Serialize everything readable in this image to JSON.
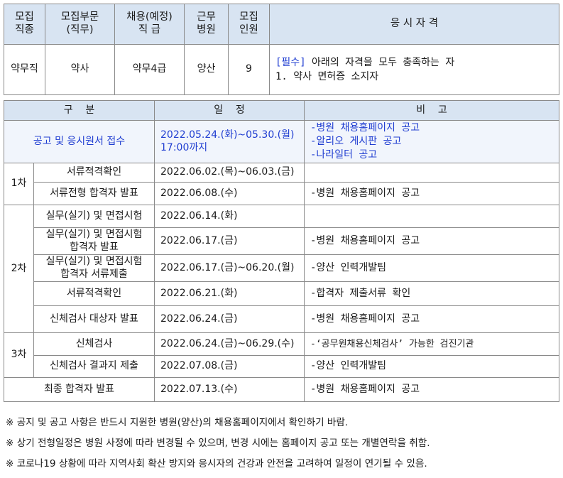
{
  "recruit": {
    "headers": [
      "모집\n직종",
      "모집부문\n(직무)",
      "채용(예정)\n직 급",
      "근무\n병원",
      "모집\n인원",
      "응 시 자 격"
    ],
    "row": {
      "job_type": "약무직",
      "dept": "약사",
      "grade": "약무4급",
      "hospital": "양산",
      "count": "9",
      "qual_tag": "[필수]",
      "qual_text": " 아래의 자격을 모두 충족하는 자",
      "qual_item": "1. 약사 면허증 소지자"
    }
  },
  "schedule": {
    "headers": {
      "category": "구    분",
      "date": "일    정",
      "remark": "비    고"
    },
    "announce": {
      "label": "공고 및 응시원서 접수",
      "date": "2022.05.24.(화)~05.30.(월)\n17:00까지",
      "remarks": [
        "-병원 채용홈페이지 공고",
        "-알리오 게시판 공고",
        "-나라일터 공고"
      ]
    },
    "stage1": {
      "label": "1차",
      "items": [
        {
          "name": "서류적격확인",
          "date": "2022.06.02.(목)~06.03.(금)",
          "remark": ""
        },
        {
          "name": "서류전형 합격자 발표",
          "date": "2022.06.08.(수)",
          "remark": "-병원 채용홈페이지 공고"
        }
      ]
    },
    "stage2": {
      "label": "2차",
      "items": [
        {
          "name": "실무(실기) 및 면접시험",
          "date": "2022.06.14.(화)",
          "remark": ""
        },
        {
          "name": "실무(실기) 및 면접시험\n합격자 발표",
          "date": "2022.06.17.(금)",
          "remark": "-병원 채용홈페이지 공고"
        },
        {
          "name": "실무(실기) 및 면접시험\n합격자 서류제출",
          "date": "2022.06.17.(금)~06.20.(월)",
          "remark": "-양산 인력개발팀"
        },
        {
          "name": "서류적격확인",
          "date": "2022.06.21.(화)",
          "remark": "-합격자 제출서류 확인"
        },
        {
          "name": "신체검사 대상자 발표",
          "date": "2022.06.24.(금)",
          "remark": "-병원 채용홈페이지 공고"
        }
      ]
    },
    "stage3": {
      "label": "3차",
      "items": [
        {
          "name": "신체검사",
          "date": "2022.06.24.(금)~06.29.(수)",
          "remark": "-‘공무원채용신체검사’ 가능한 검진기관"
        },
        {
          "name": "신체검사 결과지 제출",
          "date": "2022.07.08.(금)",
          "remark": "-양산 인력개발팀"
        }
      ]
    },
    "final": {
      "label": "최종 합격자 발표",
      "date": "2022.07.13.(수)",
      "remark": "-병원 채용홈페이지 공고"
    }
  },
  "notes": [
    "※ 공지 및 공고 사항은 반드시 지원한 병원(양산)의 채용홈페이지에서 확인하기 바람.",
    "※ 상기 전형일정은 병원 사정에 따라 변경될 수 있으며, 변경 시에는 홈페이지 공고 또는 개별연락을 취함.",
    "※ 코로나19 상황에 따라 지역사회 확산 방지와 응시자의 건강과 안전을 고려하여 일정이 연기될 수 있음."
  ],
  "colors": {
    "header_bg": "#d8e4f2",
    "accent_blue": "#1f3dd1",
    "highlight_bg": "#f1f5fc"
  }
}
